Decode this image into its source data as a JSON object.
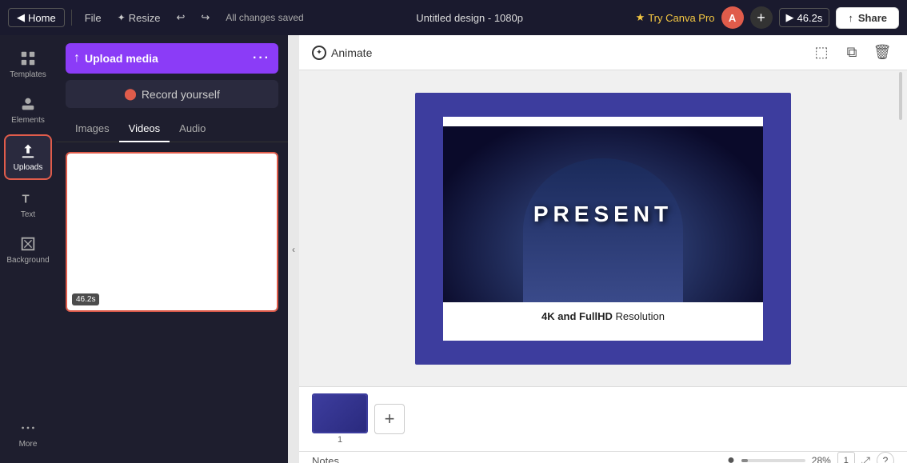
{
  "topnav": {
    "home_label": "Home",
    "file_label": "File",
    "resize_label": "Resize",
    "saved_label": "All changes saved",
    "design_title": "Untitled design - 1080p",
    "try_pro_label": "Try Canva Pro",
    "timer_label": "46.2s",
    "share_label": "Share",
    "avatar_letter": "A"
  },
  "sidebar": {
    "items": [
      {
        "label": "Templates",
        "icon": "grid"
      },
      {
        "label": "Elements",
        "icon": "elements"
      },
      {
        "label": "Uploads",
        "icon": "upload",
        "active": true
      },
      {
        "label": "Text",
        "icon": "text"
      },
      {
        "label": "Background",
        "icon": "background"
      },
      {
        "label": "More",
        "icon": "more"
      }
    ]
  },
  "panel": {
    "upload_media_label": "Upload media",
    "upload_dots": "···",
    "record_label": "Record yourself",
    "tabs": [
      {
        "label": "Images",
        "active": false
      },
      {
        "label": "Videos",
        "active": true
      },
      {
        "label": "Audio",
        "active": false
      }
    ],
    "media_items": [
      {
        "duration": "46.2s"
      }
    ]
  },
  "canvas_toolbar": {
    "animate_label": "Animate",
    "new_tab_icon": "new-tab",
    "copy_icon": "copy",
    "delete_icon": "delete"
  },
  "slide": {
    "present_text": "PRESENT",
    "caption_text": "4K and FullHD Resolution"
  },
  "bottom": {
    "notes_label": "Notes",
    "zoom_pct": "28%",
    "page_num": "1",
    "add_slide_label": "+",
    "slide_num": "1"
  }
}
